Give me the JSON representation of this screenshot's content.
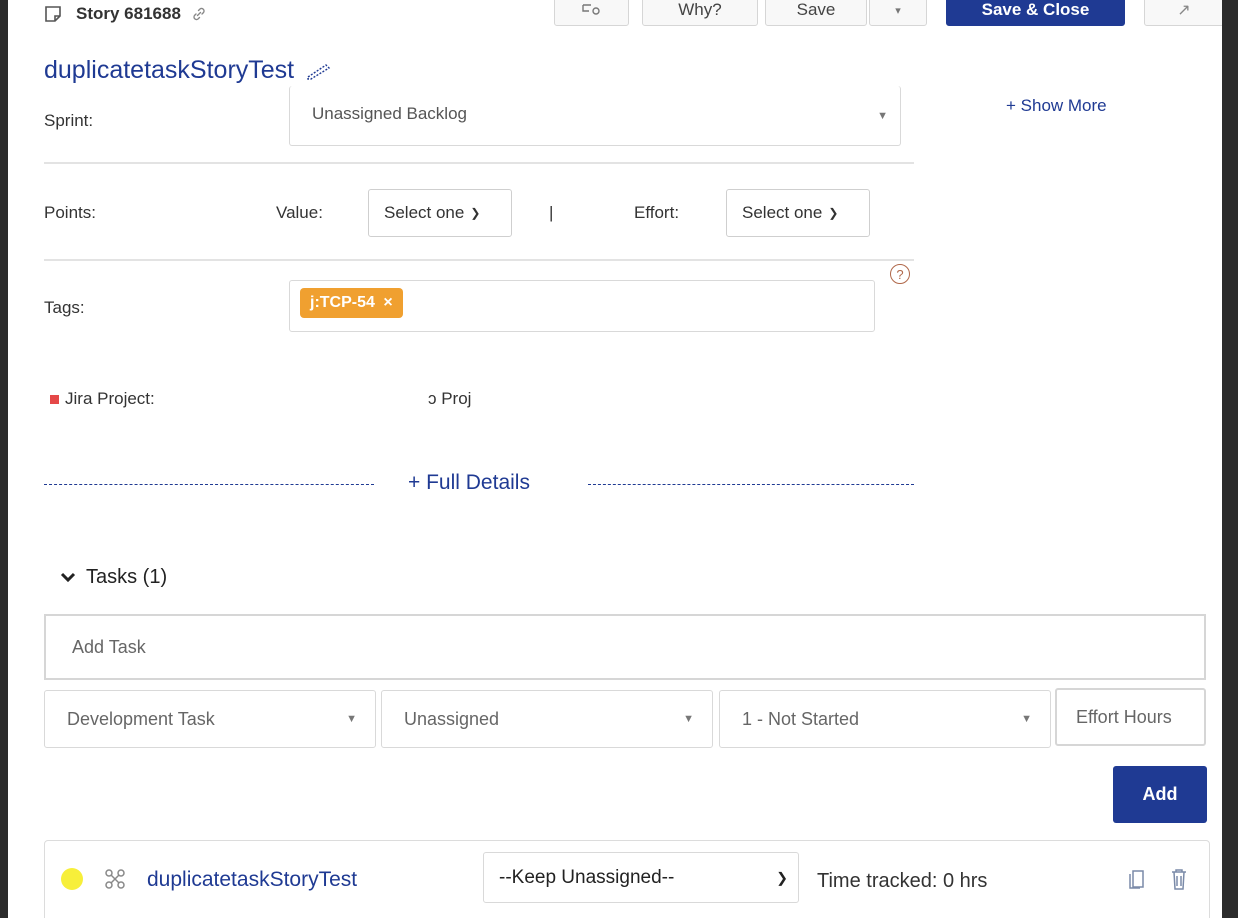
{
  "header": {
    "story_label": "Story 681688",
    "buttons": {
      "why": "Why?",
      "save": "Save",
      "save_close": "Save & Close"
    }
  },
  "title": "duplicatetaskStoryTest",
  "show_more": "+ Show More",
  "sprint": {
    "label": "Sprint:",
    "value": "Unassigned Backlog"
  },
  "points": {
    "label": "Points:",
    "value_label": "Value:",
    "value_select": "Select one",
    "separator": "|",
    "effort_label": "Effort:",
    "effort_select": "Select one"
  },
  "tags": {
    "label": "Tags:",
    "items": [
      "j:TCP-54"
    ],
    "help": "?"
  },
  "jira": {
    "label": "Jira Project:",
    "value": "ɔ Proj"
  },
  "full_details": "+ Full Details",
  "tasks": {
    "heading": "Tasks (1)",
    "add_placeholder": "Add Task",
    "type_select": "Development Task",
    "owner_select": "Unassigned",
    "status_select": "1 - Not Started",
    "effort_placeholder": "Effort Hours",
    "add_button": "Add",
    "items": [
      {
        "name": "duplicatetaskStoryTest",
        "assignee": "--Keep Unassigned--",
        "time": "Time tracked: 0 hrs"
      }
    ]
  },
  "colors": {
    "primary": "#1f3a93",
    "tag": "#f0a030",
    "status_dot": "#f7ef3a",
    "jira_marker": "#e54848"
  }
}
